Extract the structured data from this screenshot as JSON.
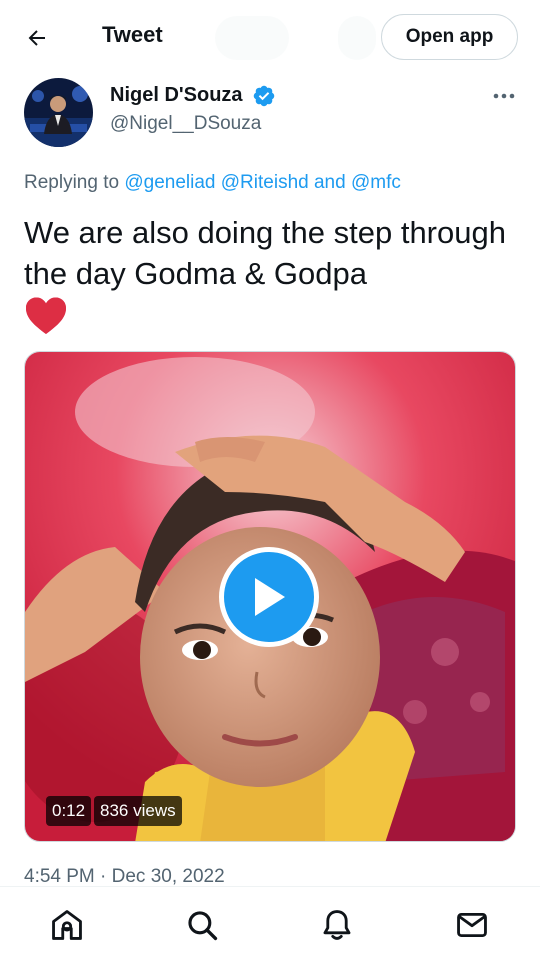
{
  "header": {
    "title": "Tweet",
    "open_app_label": "Open app"
  },
  "tweet": {
    "author": {
      "name": "Nigel D'Souza",
      "handle": "@Nigel__DSouza",
      "verified": true
    },
    "replying_prefix": "Replying to",
    "replying_to": [
      "@geneliad",
      "@Riteishd"
    ],
    "replying_and": "and",
    "replying_last": "@mfc",
    "text": "We are also doing the step through the day Godma & Godpa",
    "emoji": "red-heart",
    "media": {
      "type": "video",
      "duration": "0:12",
      "views": "836 views"
    },
    "timestamp": "4:54 PM · Dec 30, 2022"
  },
  "bottom_nav": {
    "items": [
      {
        "icon": "home-icon"
      },
      {
        "icon": "search-icon"
      },
      {
        "icon": "notifications-bell-icon"
      },
      {
        "icon": "messages-mail-icon"
      }
    ]
  },
  "colors": {
    "accent": "#1d9bf0",
    "text_primary": "#0f1419",
    "text_secondary": "#536471",
    "border": "#cfd9de"
  }
}
